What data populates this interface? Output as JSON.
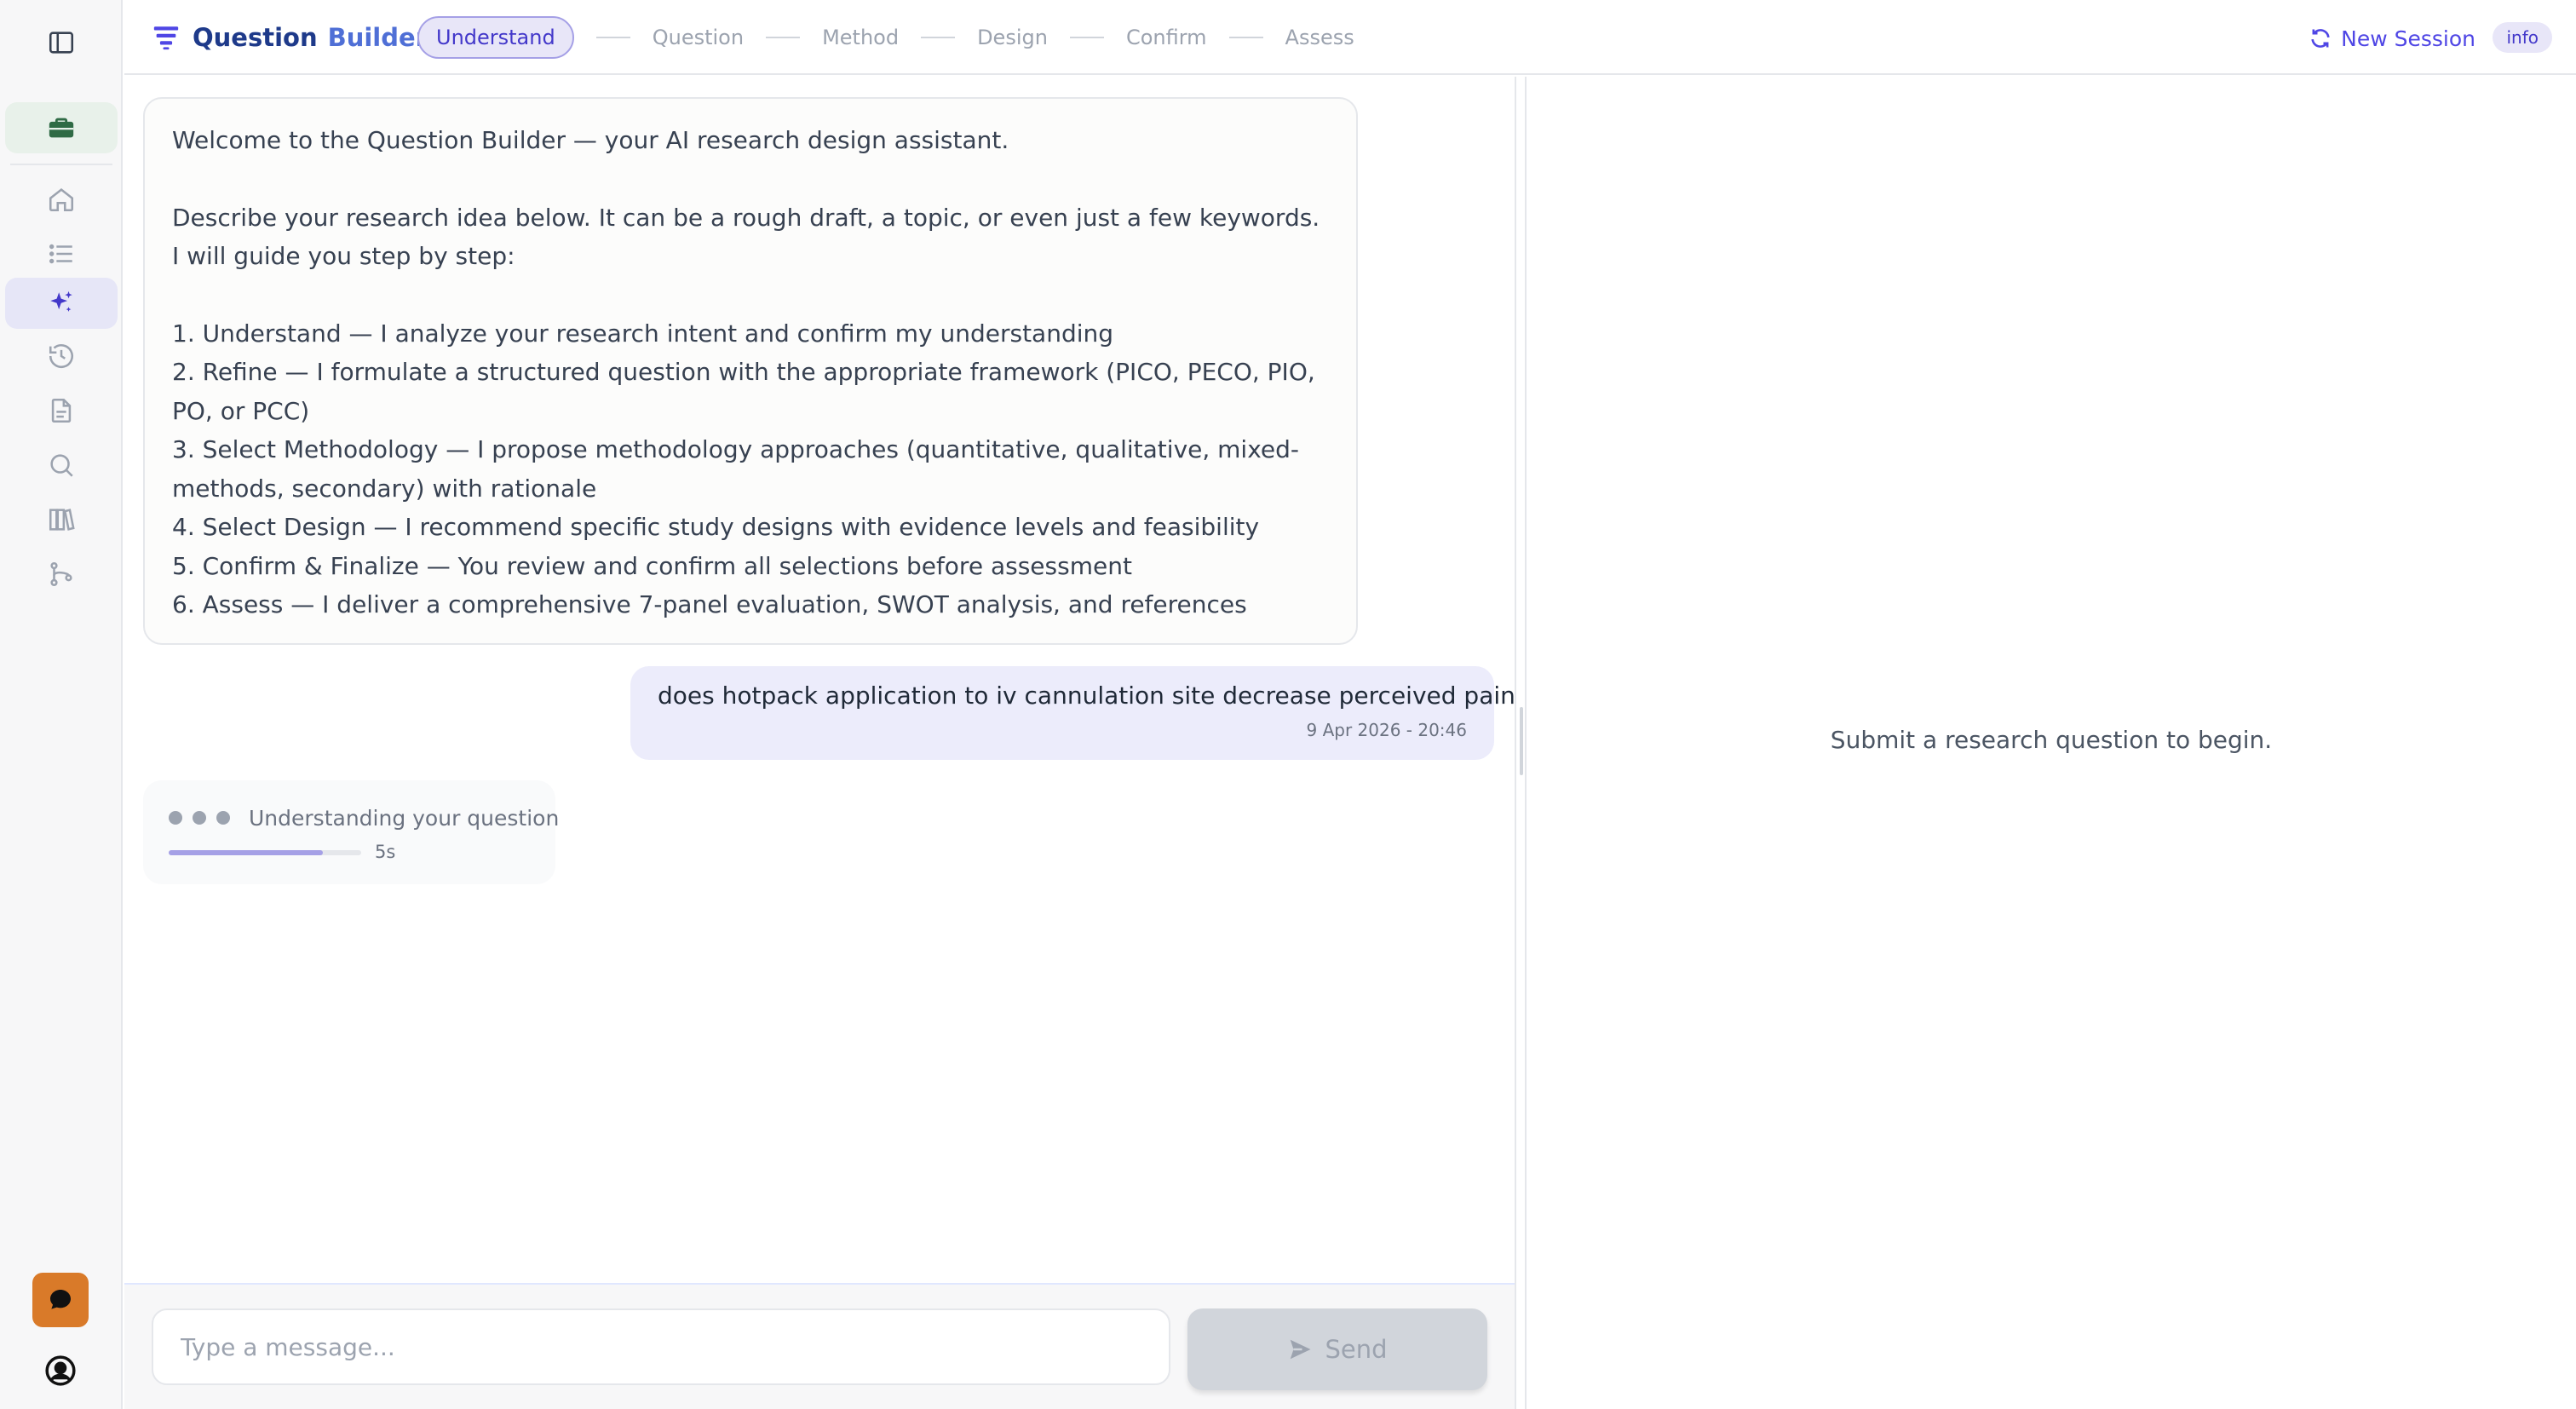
{
  "sidebar": {
    "icons": [
      "sidebar-toggle-icon",
      "briefcase-icon",
      "home-icon",
      "list-icon",
      "sparkles-icon",
      "history-icon",
      "document-icon",
      "search-icon",
      "library-icon",
      "git-branch-icon",
      "chat-icon",
      "user-circle-icon"
    ],
    "active": "sparkles-icon",
    "colors": {
      "brief_bg": "#e8f1ea",
      "active_bg": "#e6e6f7",
      "chat_bg": "#d97a29"
    }
  },
  "header": {
    "brand_first": "Question",
    "brand_second": "Builder",
    "steps": [
      "Understand",
      "Question",
      "Method",
      "Design",
      "Confirm",
      "Assess"
    ],
    "active_step": "Understand",
    "new_session_label": "New Session",
    "info_badge": "info",
    "accent": "#4f46e5"
  },
  "chat": {
    "welcome": {
      "intro": "Welcome to the Question Builder — your AI research design assistant.",
      "instruction": "Describe your research idea below. It can be a rough draft, a topic, or even just a few keywords. I will guide you step by step:",
      "steps": [
        "1. Understand — I analyze your research intent and confirm my understanding",
        "2. Refine — I formulate a structured question with the appropriate framework (PICO, PECO, PIO, PO, or PCC)",
        "3. Select Methodology — I propose methodology approaches (quantitative, qualitative, mixed-methods, secondary) with rationale",
        "4. Select Design — I recommend specific study designs with evidence levels and feasibility",
        "5. Confirm & Finalize — You review and confirm all selections before assessment",
        "6. Assess — I deliver a comprehensive 7-panel evaluation, SWOT analysis, and references"
      ]
    },
    "user_message": {
      "text": "does hotpack application to iv cannulation site decrease perceived pain",
      "timestamp": "9 Apr 2026 - 20:46"
    },
    "thinking": {
      "label": "Understanding your question",
      "elapsed": "5s",
      "progress": 0.8
    }
  },
  "composer": {
    "placeholder": "Type a message...",
    "value": "",
    "send_label": "Send"
  },
  "results": {
    "empty_text": "Submit a research question to begin."
  }
}
